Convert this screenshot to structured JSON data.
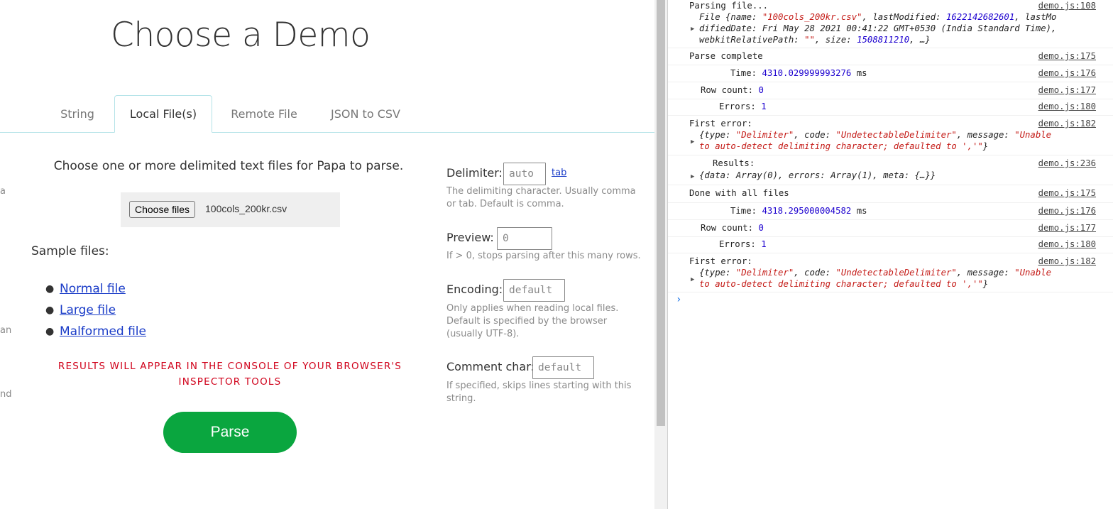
{
  "page": {
    "title": "Choose a Demo",
    "edge_fragments": [
      "a",
      "an",
      "nd"
    ],
    "tabs": [
      {
        "label": "String",
        "active": false
      },
      {
        "label": "Local File(s)",
        "active": true
      },
      {
        "label": "Remote File",
        "active": false
      },
      {
        "label": "JSON to CSV",
        "active": false
      }
    ],
    "choose_text": "Choose one or more delimited text files for Papa to parse.",
    "file_input": {
      "button_label": "Choose files",
      "file_name": "100cols_200kr.csv"
    },
    "sample_heading": "Sample files:",
    "sample_files": [
      "Normal file",
      "Large file",
      "Malformed file"
    ],
    "results_note": "RESULTS WILL APPEAR IN THE CONSOLE OF YOUR BROWSER'S INSPECTOR TOOLS",
    "parse_button": "Parse",
    "options": {
      "delimiter": {
        "label": "Delimiter:",
        "value": "auto",
        "link": "tab",
        "help": "The delimiting character. Usually comma or tab. Default is comma."
      },
      "preview": {
        "label": "Preview:",
        "value": "0",
        "help": "If > 0, stops parsing after this many rows."
      },
      "encoding": {
        "label": "Encoding:",
        "value": "default",
        "help": "Only applies when reading local files. Default is specified by the browser (usually UTF-8)."
      },
      "comment": {
        "label": "Comment char:",
        "value": "default",
        "help": "If specified, skips lines starting with this string."
      }
    }
  },
  "console": {
    "entries": [
      {
        "text": "Parsing file...",
        "source": "demo.js:108"
      },
      {
        "text": "Parse complete",
        "source": "demo.js:175"
      },
      {
        "text": "Time:",
        "value": "4310.029999993276",
        "unit": "ms",
        "source": "demo.js:176"
      },
      {
        "text": "Row count:",
        "value": "0",
        "source": "demo.js:177"
      },
      {
        "text": "Errors:",
        "value": "1",
        "source": "demo.js:180"
      },
      {
        "text": "First error:",
        "source": "demo.js:182"
      },
      {
        "text": "Results:",
        "source": "demo.js:236"
      },
      {
        "text": "Done with all files",
        "source": "demo.js:175"
      },
      {
        "text": "Time:",
        "value": "4318.295000004582",
        "unit": "ms",
        "source": "demo.js:176"
      },
      {
        "text": "Row count:",
        "value": "0",
        "source": "demo.js:177"
      },
      {
        "text": "Errors:",
        "value": "1",
        "source": "demo.js:180"
      },
      {
        "text": "First error:",
        "source": "demo.js:182"
      }
    ],
    "file_obj": {
      "prefix": "File {",
      "name_key": "name: ",
      "name_val": "\"100cols_200kr.csv\"",
      "lastmod_key": ", lastModified: ",
      "lastmod_val": "1622142682601",
      "lastmod_tail": ", lastMo",
      "line2_key": "difiedDate: ",
      "line2_val": "Fri May 28 2021 00:41:22 GMT+0530 (India Standard Time),",
      "line3_key": "webkitRelativePath: ",
      "line3_val": "\"\"",
      "size_key": ", size: ",
      "size_val": "1508811210",
      "line3_tail": ", …}"
    },
    "error_obj": {
      "type_key": "{type: ",
      "type_val": "\"Delimiter\"",
      "code_key": ", code: ",
      "code_val": "\"UndetectableDelimiter\"",
      "msg_key": ", message: ",
      "msg_val1": "\"Unable",
      "msg_val2": "to auto-detect delimiting character; defaulted to ','\"",
      "close": "}"
    },
    "results_obj": "{data: Array(0), errors: Array(1), meta: {…}}",
    "prompt": "›"
  },
  "colors": {
    "parse_button": "#0aa63f",
    "results_note": "#d0021b",
    "link": "#1a3cc8",
    "tab_border": "#b4e3e8",
    "console_string": "#c41a16",
    "console_number": "#1c00cf"
  }
}
